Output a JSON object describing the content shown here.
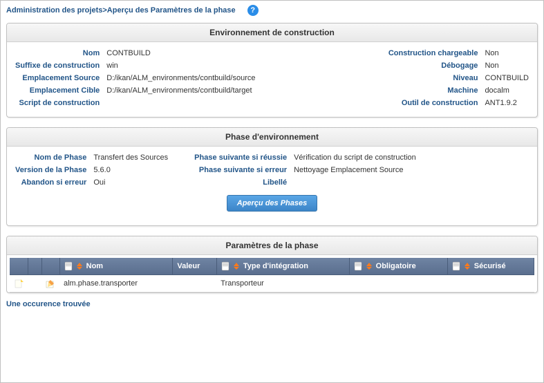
{
  "breadcrumb": {
    "part1": "Administration des projets",
    "sep": ">",
    "part2": "Aperçu des Paramètres de la phase"
  },
  "env_panel": {
    "title": "Environnement de construction",
    "left": {
      "label_nom": "Nom",
      "val_nom": "CONTBUILD",
      "label_suffixe": "Suffixe de construction",
      "val_suffixe": "win",
      "label_src": "Emplacement Source",
      "val_src": "D:/ikan/ALM_environments/contbuild/source",
      "label_tgt": "Emplacement Cible",
      "val_tgt": "D:/ikan/ALM_environments/contbuild/target",
      "label_script": "Script de construction",
      "val_script": ""
    },
    "right": {
      "label_chargeable": "Construction chargeable",
      "val_chargeable": "Non",
      "label_debug": "Débogage",
      "val_debug": "Non",
      "label_niveau": "Niveau",
      "val_niveau": "CONTBUILD",
      "label_machine": "Machine",
      "val_machine": "docalm",
      "label_outil": "Outil de construction",
      "val_outil": "ANT1.9.2"
    }
  },
  "phase_panel": {
    "title": "Phase d'environnement",
    "left": {
      "label_nom": "Nom de Phase",
      "val_nom": "Transfert des Sources",
      "label_ver": "Version de la Phase",
      "val_ver": "5.6.0",
      "label_abandon": "Abandon si erreur",
      "val_abandon": "Oui"
    },
    "right": {
      "label_reussie": "Phase suivante si réussie",
      "val_reussie": "Vérification du script de construction",
      "label_erreur": "Phase suivante si erreur",
      "val_erreur": "Nettoyage Emplacement Source",
      "label_libelle": "Libellé",
      "val_libelle": ""
    },
    "button": "Aperçu des Phases"
  },
  "params_panel": {
    "title": "Paramètres de la phase",
    "cols": {
      "nom": "Nom",
      "valeur": "Valeur",
      "type": "Type d'intégration",
      "obligatoire": "Obligatoire",
      "securise": "Sécurisé"
    },
    "row": {
      "nom": "alm.phase.transporter",
      "valeur": "",
      "type": "Transporteur",
      "obligatoire": "",
      "securise": ""
    },
    "footer": "Une occurence trouvée"
  }
}
